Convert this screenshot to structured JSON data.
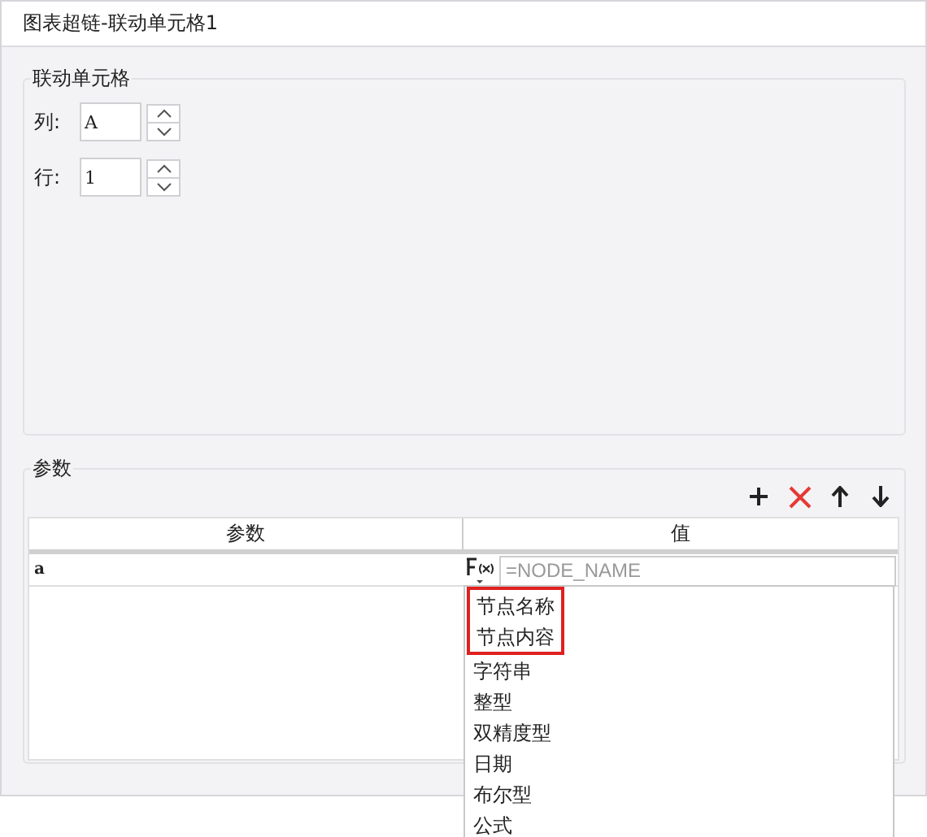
{
  "window": {
    "title": "图表超链-联动单元格1"
  },
  "linked_cell": {
    "legend": "联动单元格",
    "fields": [
      {
        "label": "列:",
        "value": "A"
      },
      {
        "label": "行:",
        "value": "1"
      }
    ]
  },
  "params": {
    "legend": "参数",
    "toolbar": [
      {
        "kind": "add"
      },
      {
        "kind": "delete"
      },
      {
        "kind": "up"
      },
      {
        "kind": "down"
      }
    ],
    "columns": [
      "参数",
      "值"
    ],
    "rows": [
      {
        "name": "a",
        "value_placeholder": "=NODE_NAME"
      }
    ],
    "dropdown": [
      {
        "label": "节点名称",
        "highlighted": true
      },
      {
        "label": "节点内容",
        "highlighted": true
      },
      {
        "label": "字符串",
        "highlighted": false
      },
      {
        "label": "整型",
        "highlighted": false
      },
      {
        "label": "双精度型",
        "highlighted": false
      },
      {
        "label": "日期",
        "highlighted": false
      },
      {
        "label": "布尔型",
        "highlighted": false
      },
      {
        "label": "公式",
        "highlighted": false
      }
    ]
  }
}
